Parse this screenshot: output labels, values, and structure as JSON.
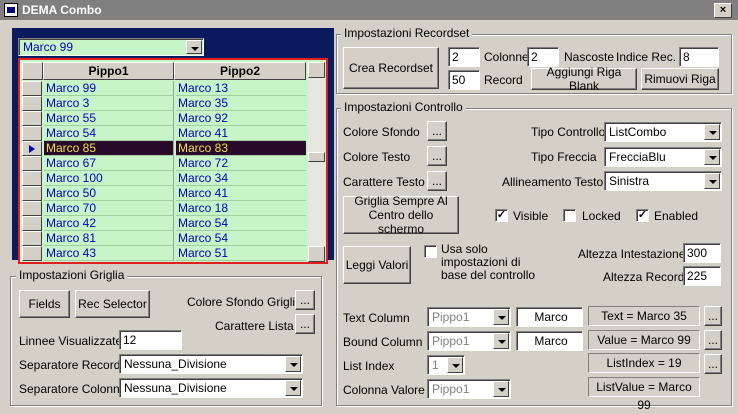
{
  "window": {
    "title": "DEMA Combo",
    "close_label": "×"
  },
  "top_combo": {
    "value": "Marco 99"
  },
  "grid": {
    "headers": [
      "Pippo1",
      "Pippo2"
    ],
    "rows": [
      [
        "Marco 99",
        "Marco 13"
      ],
      [
        "Marco 3",
        "Marco 35"
      ],
      [
        "Marco 55",
        "Marco 92"
      ],
      [
        "Marco 54",
        "Marco 41"
      ],
      [
        "Marco 85",
        "Marco 83"
      ],
      [
        "Marco 67",
        "Marco 72"
      ],
      [
        "Marco 100",
        "Marco 34"
      ],
      [
        "Marco 50",
        "Marco 41"
      ],
      [
        "Marco 70",
        "Marco 18"
      ],
      [
        "Marco 42",
        "Marco 54"
      ],
      [
        "Marco 81",
        "Marco 54"
      ],
      [
        "Marco 43",
        "Marco 51"
      ]
    ],
    "selected_index": 4
  },
  "recordset": {
    "group_label": "Impostazioni Recordset",
    "create_button": "Crea Recordset",
    "colonne_label": "Colonne",
    "colonne_value": "2",
    "nascoste_label": "Nascoste",
    "nascoste_value": "2",
    "indice_label": "Indice Rec.",
    "indice_value": "8",
    "record_label": "Record",
    "record_value": "50",
    "add_blank_button": "Aggiungi Riga Blank",
    "remove_row_button": "Rimuovi Riga"
  },
  "controllo": {
    "group_label": "Impostazioni Controllo",
    "colore_sfondo_label": "Colore Sfondo",
    "colore_testo_label": "Colore Testo",
    "carattere_testo_label": "Carattere Testo",
    "ellipsis": "...",
    "tipo_controllo_label": "Tipo Controllo",
    "tipo_controllo_value": "ListCombo",
    "tipo_freccia_label": "Tipo Freccia",
    "tipo_freccia_value": "FrecciaBlu",
    "allineamento_label": "Allineamento Testo",
    "allineamento_value": "Sinistra",
    "griglia_button": "Griglia Sempre Al Centro dello schermo",
    "visible_label": "Visible",
    "visible_checked": true,
    "locked_label": "Locked",
    "locked_checked": false,
    "enabled_label": "Enabled",
    "enabled_checked": true,
    "leggi_valori_button": "Leggi Valori",
    "usa_solo_label": "Usa solo impostazioni di base del controllo",
    "usa_solo_checked": false,
    "altezza_intestazione_label": "Altezza Intestazione",
    "altezza_intestazione_value": "300",
    "altezza_record_label": "Altezza Record",
    "altezza_record_value": "225",
    "text_column_label": "Text Column",
    "text_column_combo": "Pippo1",
    "text_column_value": "Marco",
    "text_info": "Text = Marco 35",
    "bound_column_label": "Bound Column",
    "bound_column_combo": "Pippo1",
    "bound_column_value": "Marco",
    "value_info": "Value = Marco 99",
    "list_index_label": "List Index",
    "list_index_combo": "1",
    "listindex_info": "ListIndex = 19",
    "colonna_valore_label": "Colonna Valore",
    "colonna_valore_combo": "Pippo1",
    "listvalue_info": "ListValue = Marco 99"
  },
  "griglia": {
    "group_label": "Impostazioni Griglia",
    "fields_button": "Fields",
    "rec_selector_button": "Rec Selector",
    "colore_sfondo_griglia_label": "Colore Sfondo Griglia",
    "carattere_lista_label": "Carattere Lista",
    "linee_label": "Linnee Visualizzate",
    "linee_value": "12",
    "sep_record_label": "Separatore Record",
    "sep_record_value": "Nessuna_Divisione",
    "sep_colonne_label": "Separatore Colonne",
    "sep_colonne_value": "Nessuna_Divisione"
  }
}
